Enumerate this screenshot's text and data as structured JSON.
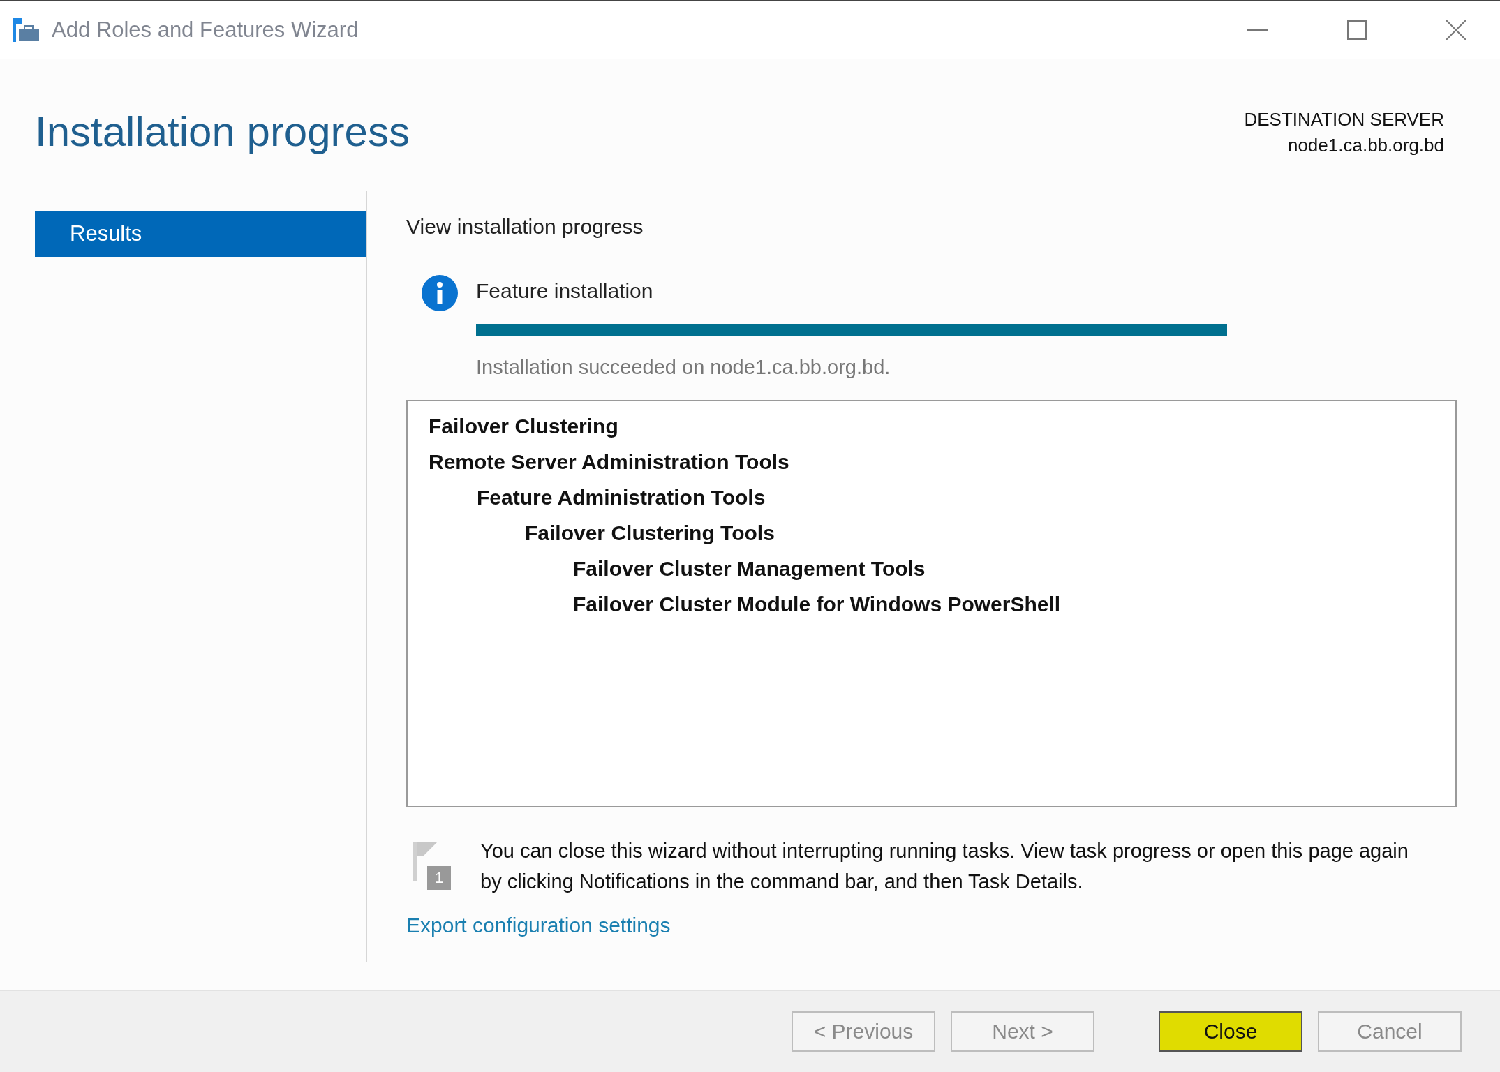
{
  "window": {
    "title": "Add Roles and Features Wizard"
  },
  "header": {
    "title": "Installation progress",
    "destination_label": "DESTINATION SERVER",
    "destination_server": "node1.ca.bb.org.bd"
  },
  "sidebar": {
    "items": [
      {
        "label": "Results",
        "selected": true
      }
    ]
  },
  "content": {
    "heading": "View installation progress",
    "progress": {
      "label": "Feature installation",
      "level": 1,
      "status": "Installation succeeded on node1.ca.bb.org.bd."
    },
    "features": [
      {
        "label": "Failover Clustering"
      },
      {
        "label": "Remote Server Administration Tools",
        "children": [
          {
            "label": "Feature Administration Tools",
            "children": [
              {
                "label": "Failover Clustering Tools",
                "children": [
                  {
                    "label": "Failover Cluster Management Tools"
                  },
                  {
                    "label": "Failover Cluster Module for Windows PowerShell"
                  }
                ]
              }
            ]
          }
        ]
      }
    ],
    "notice": {
      "badge": "1",
      "text": "You can close this wizard without interrupting running tasks. View task progress or open this page again by clicking Notifications in the command bar, and then Task Details."
    },
    "link": "Export configuration settings"
  },
  "buttons": [
    {
      "label": "< Previous",
      "disabled": true,
      "highlighted": false
    },
    {
      "label": "Next >",
      "disabled": true,
      "highlighted": false
    },
    {
      "label": "Close",
      "disabled": false,
      "highlighted": true
    },
    {
      "label": "Cancel",
      "disabled": true,
      "highlighted": false
    }
  ]
}
